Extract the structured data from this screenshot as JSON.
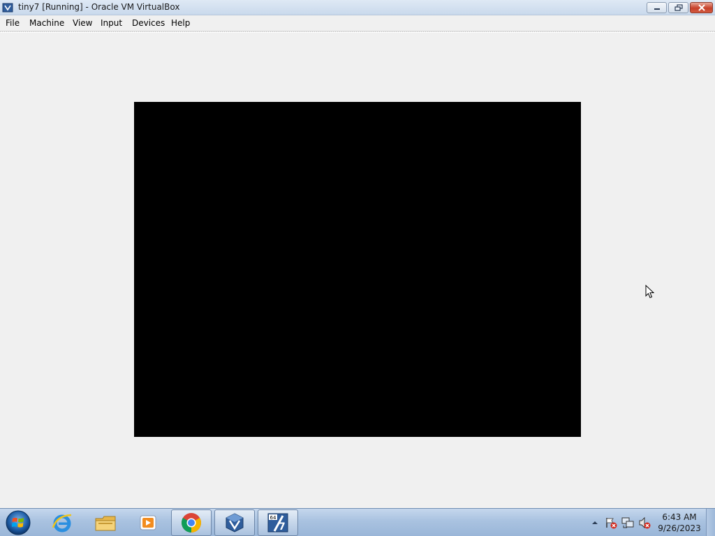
{
  "window": {
    "title": "tiny7 [Running] - Oracle VM VirtualBox"
  },
  "menu": {
    "items": [
      "File",
      "Machine",
      "View",
      "Input",
      "Devices",
      "Help"
    ]
  },
  "guest_display": {
    "state": "black screen"
  },
  "taskbar": {
    "start_icon": "windows-logo-icon",
    "pinned": [
      {
        "name": "internet-explorer-icon",
        "active": false
      },
      {
        "name": "file-explorer-icon",
        "active": false
      },
      {
        "name": "media-player-icon",
        "active": false
      },
      {
        "name": "chrome-icon",
        "active": true
      },
      {
        "name": "virtualbox-icon",
        "active": true
      },
      {
        "name": "tiny7-vm-icon",
        "active": true
      }
    ],
    "tray": {
      "icons": [
        "show-hidden-icons-icon",
        "action-center-flag-icon",
        "network-icon",
        "volume-muted-icon"
      ]
    },
    "clock": {
      "time": "6:43 AM",
      "date": "9/26/2023"
    }
  },
  "colors": {
    "titlebar": "#dfe9f5",
    "window_bg": "#f0f0f0",
    "vm_screen": "#000000",
    "taskbar": "#a9c2e0",
    "close_button": "#c7402a"
  }
}
